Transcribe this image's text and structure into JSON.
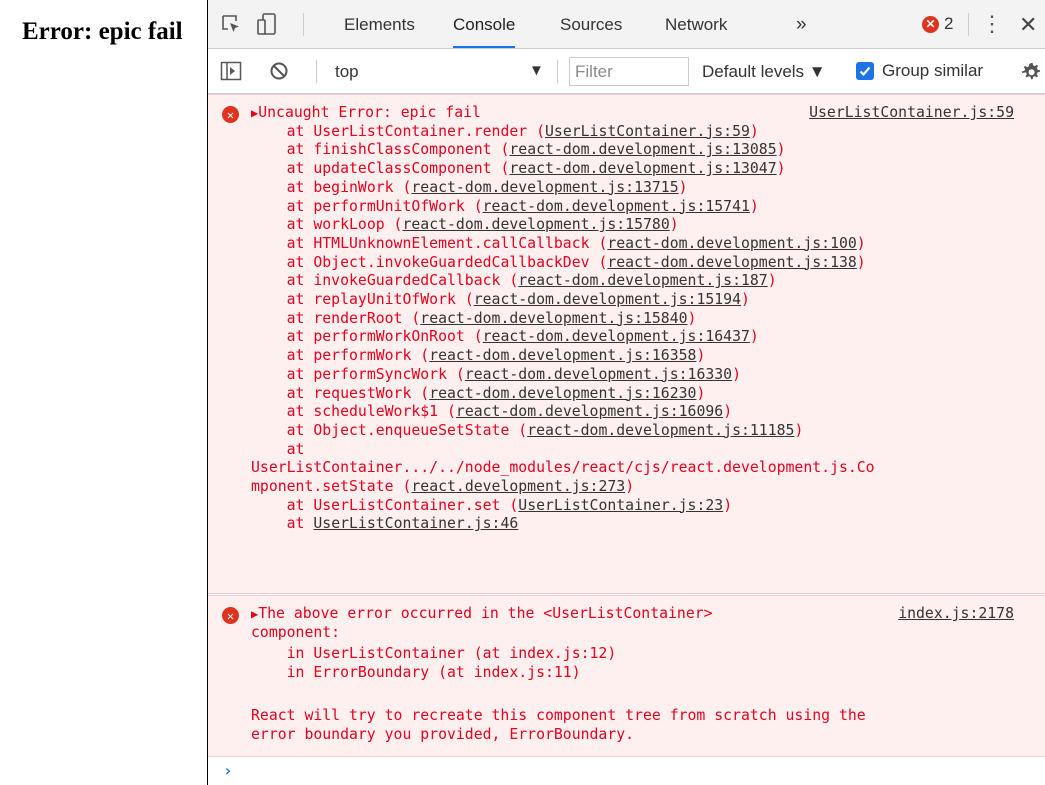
{
  "page": {
    "heading": "Error: epic fail"
  },
  "devtools": {
    "tabs": [
      "Elements",
      "Console",
      "Sources",
      "Network"
    ],
    "more_tabs": "»",
    "error_count": "2",
    "toolbar": {
      "context": "top",
      "filter_placeholder": "Filter",
      "levels": "Default levels ▼",
      "group_similar": "Group similar"
    }
  },
  "console": {
    "error1": {
      "message": "Uncaught Error: epic fail",
      "source": "UserListContainer.js:59",
      "stack": [
        {
          "fn": "at UserListContainer.render",
          "file": "UserListContainer.js:59"
        },
        {
          "fn": "at finishClassComponent",
          "file": "react-dom.development.js:13085"
        },
        {
          "fn": "at updateClassComponent",
          "file": "react-dom.development.js:13047"
        },
        {
          "fn": "at beginWork",
          "file": "react-dom.development.js:13715"
        },
        {
          "fn": "at performUnitOfWork",
          "file": "react-dom.development.js:15741"
        },
        {
          "fn": "at workLoop",
          "file": "react-dom.development.js:15780"
        },
        {
          "fn": "at HTMLUnknownElement.callCallback",
          "file": "react-dom.development.js:100"
        },
        {
          "fn": "at Object.invokeGuardedCallbackDev",
          "file": "react-dom.development.js:138"
        },
        {
          "fn": "at invokeGuardedCallback",
          "file": "react-dom.development.js:187"
        },
        {
          "fn": "at replayUnitOfWork",
          "file": "react-dom.development.js:15194"
        },
        {
          "fn": "at renderRoot",
          "file": "react-dom.development.js:15840"
        },
        {
          "fn": "at performWorkOnRoot",
          "file": "react-dom.development.js:16437"
        },
        {
          "fn": "at performWork",
          "file": "react-dom.development.js:16358"
        },
        {
          "fn": "at performSyncWork",
          "file": "react-dom.development.js:16330"
        },
        {
          "fn": "at requestWork",
          "file": "react-dom.development.js:16230"
        },
        {
          "fn": "at scheduleWork$1",
          "file": "react-dom.development.js:16096"
        },
        {
          "fn": "at Object.enqueueSetState",
          "file": "react-dom.development.js:11185"
        }
      ],
      "stack_at": "at",
      "stack_wrapped_1": "UserListContainer.../../node_modules/react/cjs/react.development.js.Co",
      "stack_wrapped_2_fn": "mponent.setState",
      "stack_wrapped_2_file": "react.development.js:273",
      "stack_tail": [
        {
          "fn": "at UserListContainer.set",
          "file": "UserListContainer.js:23"
        }
      ],
      "stack_last_at": "at",
      "stack_last_file": "UserListContainer.js:46"
    },
    "error2": {
      "message_1": "The above error occurred in the <UserListContainer>",
      "message_2": "component:",
      "source": "index.js:2178",
      "lines": [
        "    in UserListContainer (at index.js:12)",
        "    in ErrorBoundary (at index.js:11)"
      ],
      "note_1": "React will try to recreate this component tree from scratch using the",
      "note_2": "error boundary you provided, ErrorBoundary."
    },
    "prompt": "›"
  }
}
